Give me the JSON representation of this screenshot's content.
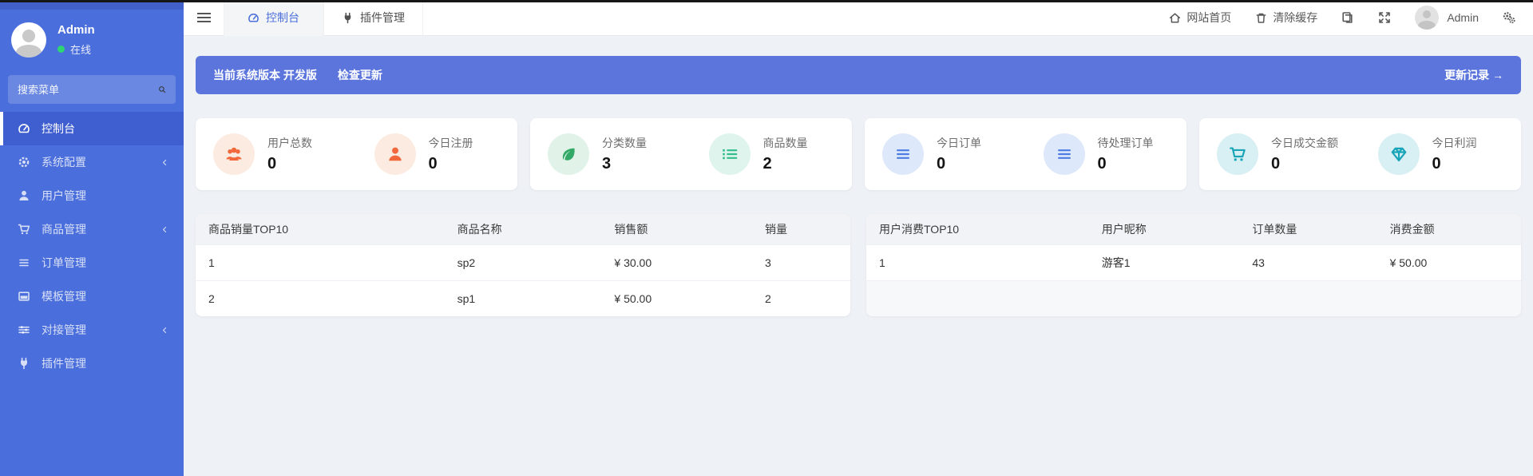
{
  "colors": {
    "sidebar": "#4a6edb",
    "sidebar_active": "#3f5ecf",
    "banner": "#5b75dc",
    "content_bg": "#eef1f6",
    "accent_orange": "#f1683c",
    "accent_green": "#33a968",
    "accent_mint": "#31bd8c",
    "accent_blue": "#4d7ce4",
    "accent_teal": "#19a5b8",
    "online_dot": "#2ed573"
  },
  "sidebar": {
    "user": {
      "name": "Admin",
      "status": "在线"
    },
    "search_placeholder": "搜索菜单",
    "items": [
      {
        "label": "控制台",
        "icon": "dashboard-icon",
        "active": true,
        "has_arrow": false
      },
      {
        "label": "系统配置",
        "icon": "gear-icon",
        "active": false,
        "has_arrow": true
      },
      {
        "label": "用户管理",
        "icon": "user-icon",
        "active": false,
        "has_arrow": false
      },
      {
        "label": "商品管理",
        "icon": "cart-icon",
        "active": false,
        "has_arrow": true
      },
      {
        "label": "订单管理",
        "icon": "bars-icon",
        "active": false,
        "has_arrow": false
      },
      {
        "label": "模板管理",
        "icon": "template-icon",
        "active": false,
        "has_arrow": false
      },
      {
        "label": "对接管理",
        "icon": "sliders-icon",
        "active": false,
        "has_arrow": true
      },
      {
        "label": "插件管理",
        "icon": "plug-icon",
        "active": false,
        "has_arrow": false
      }
    ]
  },
  "topbar": {
    "tabs": [
      {
        "label": "控制台",
        "icon": "dashboard-icon",
        "active": true
      },
      {
        "label": "插件管理",
        "icon": "plug-icon",
        "active": false
      }
    ],
    "home_label": "网站首页",
    "clear_cache_label": "清除缓存",
    "username": "Admin"
  },
  "banner": {
    "version_text": "当前系统版本 开发版",
    "check_update": "检查更新",
    "update_log": "更新记录 →"
  },
  "stats": [
    {
      "label": "用户总数",
      "value": "0",
      "icon": "users-icon"
    },
    {
      "label": "今日注册",
      "value": "0",
      "icon": "user-icon"
    },
    {
      "label": "分类数量",
      "value": "3",
      "icon": "leaf-icon"
    },
    {
      "label": "商品数量",
      "value": "2",
      "icon": "list-icon"
    },
    {
      "label": "今日订单",
      "value": "0",
      "icon": "bars-icon"
    },
    {
      "label": "待处理订单",
      "value": "0",
      "icon": "bars-icon"
    },
    {
      "label": "今日成交金额",
      "value": "0",
      "icon": "cart-icon"
    },
    {
      "label": "今日利润",
      "value": "0",
      "icon": "diamond-icon"
    }
  ],
  "tables": [
    {
      "headers": [
        "商品销量TOP10",
        "商品名称",
        "销售额",
        "销量"
      ],
      "rows": [
        [
          "1",
          "sp2",
          "¥ 30.00",
          "3"
        ],
        [
          "2",
          "sp1",
          "¥ 50.00",
          "2"
        ]
      ]
    },
    {
      "headers": [
        "用户消费TOP10",
        "用户昵称",
        "订单数量",
        "消费金额"
      ],
      "rows": [
        [
          "1",
          "游客1",
          "43",
          "¥ 50.00"
        ],
        [
          "",
          "",
          "",
          ""
        ]
      ]
    }
  ]
}
